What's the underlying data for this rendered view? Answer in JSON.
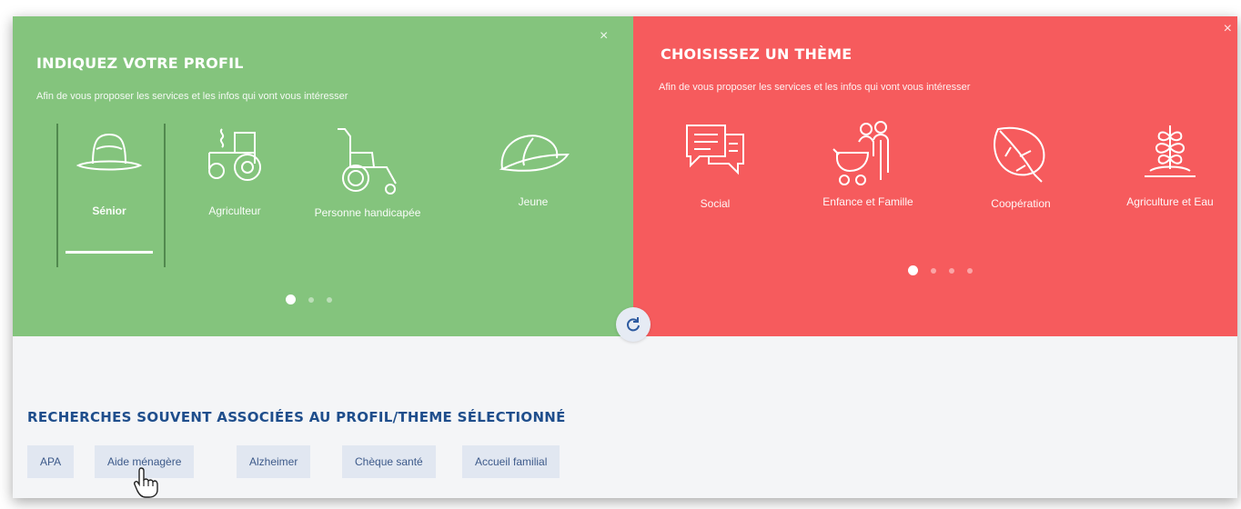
{
  "profile": {
    "title": "INDIQUEZ VOTRE PROFIL",
    "subtitle": "Afin de vous proposer les services et les infos qui vont vous intéresser",
    "items": [
      {
        "label": "Sénior",
        "icon": "hat-icon",
        "selected": true
      },
      {
        "label": "Agriculteur",
        "icon": "tractor-icon",
        "selected": false
      },
      {
        "label": "Personne handicapée",
        "icon": "wheelchair-icon",
        "selected": false
      },
      {
        "label": "Jeune",
        "icon": "cap-icon",
        "selected": false
      }
    ],
    "page_dots": 3,
    "active_dot": 0,
    "close_label": "×"
  },
  "theme": {
    "title": "CHOISISSEZ UN THÈME",
    "subtitle": "Afin de vous proposer les services et les infos qui vont vous intéresser",
    "items": [
      {
        "label": "Social",
        "icon": "speech-bubbles-icon"
      },
      {
        "label": "Enfance et Famille",
        "icon": "family-stroller-icon"
      },
      {
        "label": "Coopération",
        "icon": "leaf-icon"
      },
      {
        "label": "Agriculture et Eau",
        "icon": "plant-sprout-icon"
      }
    ],
    "page_dots": 4,
    "active_dot": 0,
    "close_label": "×"
  },
  "refresh": {
    "icon": "refresh-icon"
  },
  "searches": {
    "title": "RECHERCHES SOUVENT ASSOCIÉES AU PROFIL/THEME SÉLECTIONNÉ",
    "tags": [
      "APA",
      "Aide ménagère",
      "Alzheimer",
      "Chèque santé",
      "Accueil familial"
    ]
  },
  "colors": {
    "profile_bg": "#84c47d",
    "theme_bg": "#f65b5d",
    "section_title": "#1f4e8c",
    "tag_bg": "#e1e7f1"
  }
}
